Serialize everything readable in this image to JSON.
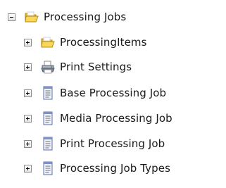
{
  "tree": {
    "root": {
      "label": "Processing Jobs",
      "icon": "folder-open-icon",
      "expanded": true
    },
    "children": [
      {
        "label": "ProcessingItems",
        "icon": "folder-open-icon",
        "expanded": false
      },
      {
        "label": "Print Settings",
        "icon": "printer-icon",
        "expanded": false
      },
      {
        "label": "Base Processing Job",
        "icon": "document-icon",
        "expanded": false
      },
      {
        "label": "Media Processing Job",
        "icon": "document-icon",
        "expanded": false
      },
      {
        "label": "Print Processing Job",
        "icon": "document-icon",
        "expanded": false
      },
      {
        "label": "Processing Job Types",
        "icon": "document-icon",
        "expanded": false
      }
    ]
  },
  "colors": {
    "folder": "#f6cf4a",
    "folder_dark": "#c99a12",
    "doc_border": "#5a6fa8",
    "doc_fill": "#eef2fb",
    "text": "#1a1a1a"
  }
}
